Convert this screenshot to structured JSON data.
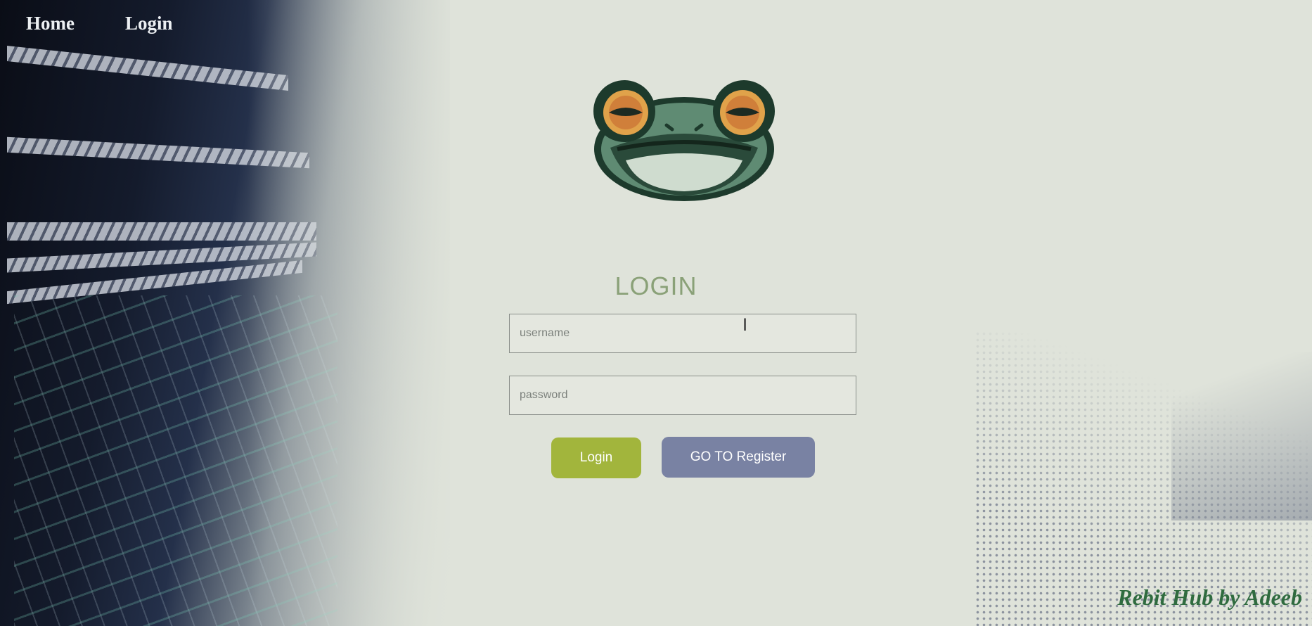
{
  "nav": {
    "items": [
      "Home",
      "Login"
    ]
  },
  "form": {
    "title": "LOGIN",
    "username_placeholder": "username",
    "username_value": "",
    "password_placeholder": "password",
    "password_value": "",
    "login_label": "Login",
    "register_label": "GO TO Register"
  },
  "footer": {
    "text": "Rebit Hub by Adeeb"
  },
  "logo": {
    "icon": "frog-logo-icon"
  },
  "colors": {
    "title": "#8aa178",
    "login_button": "#a2b53c",
    "register_button": "#7982a3",
    "footer_text": "#2f6b3f",
    "nav_text": "#eceff2"
  }
}
